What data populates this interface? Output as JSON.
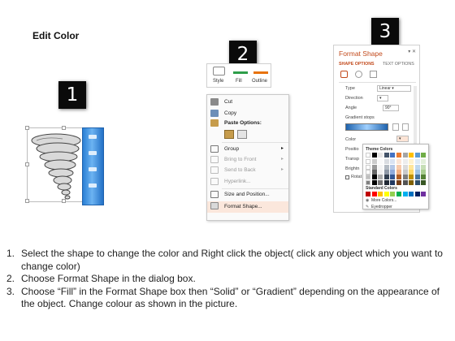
{
  "title": "Edit Color",
  "badges": [
    "1",
    "2",
    "3"
  ],
  "mini_toolbar": {
    "items": [
      "Style",
      "Fill",
      "Outline"
    ],
    "fill_color": "#2e9e4a",
    "outline_color": "#e8730c"
  },
  "context_menu": {
    "items": [
      {
        "label": "Cut",
        "icon": "scissors-icon",
        "disabled": false
      },
      {
        "label": "Copy",
        "icon": "copy-icon",
        "disabled": false
      },
      {
        "label": "Paste Options:",
        "icon": "clipboard-icon",
        "disabled": false,
        "bold": true
      },
      {
        "label": "Group",
        "icon": "group-icon",
        "disabled": false,
        "submenu": true
      },
      {
        "label": "Bring to Front",
        "icon": "bring-front-icon",
        "disabled": true,
        "submenu": true
      },
      {
        "label": "Send to Back",
        "icon": "send-back-icon",
        "disabled": true,
        "submenu": true
      },
      {
        "label": "Hyperlink...",
        "icon": "hyperlink-icon",
        "disabled": true
      },
      {
        "label": "Size and Position...",
        "icon": "size-position-icon",
        "disabled": false
      },
      {
        "label": "Format Shape...",
        "icon": "format-shape-icon",
        "disabled": false,
        "highlighted": true
      }
    ]
  },
  "format_pane": {
    "title": "Format Shape",
    "tabs": [
      "SHAPE OPTIONS",
      "TEXT OPTIONS"
    ],
    "rows": [
      "Type",
      "Direction",
      "Angle",
      "Gradient stops",
      "Color",
      "Positio",
      "Transp",
      "Brightn",
      "Rotat"
    ],
    "type_value": "Linear",
    "angle_value": "90°",
    "accent_color": "#c24a1c"
  },
  "color_popup": {
    "theme_heading": "Theme Colors",
    "standard_heading": "Standard Colors",
    "more_colors": "More Colors...",
    "eyedropper": "Eyedropper",
    "theme_top_row": [
      "#ffffff",
      "#000000",
      "#e7e6e6",
      "#44546a",
      "#4472c4",
      "#ed7d31",
      "#a5a5a5",
      "#ffc000",
      "#5b9bd5",
      "#70ad47"
    ],
    "standard_row": [
      "#c00000",
      "#ff0000",
      "#ffc000",
      "#ffff00",
      "#92d050",
      "#00b050",
      "#00b0f0",
      "#0070c0",
      "#002060",
      "#7030a0"
    ]
  },
  "steps": [
    {
      "num": "1.",
      "text": "Select the shape to change the color and Right click the object( click any object which you want to change color)"
    },
    {
      "num": "2.",
      "text": "Choose Format Shape in the dialog box."
    },
    {
      "num": "3.",
      "text": "Choose “Fill” in the Format Shape box then “Solid” or “Gradient” depending on the appearance of the object. Change colour as shown in the picture."
    }
  ]
}
